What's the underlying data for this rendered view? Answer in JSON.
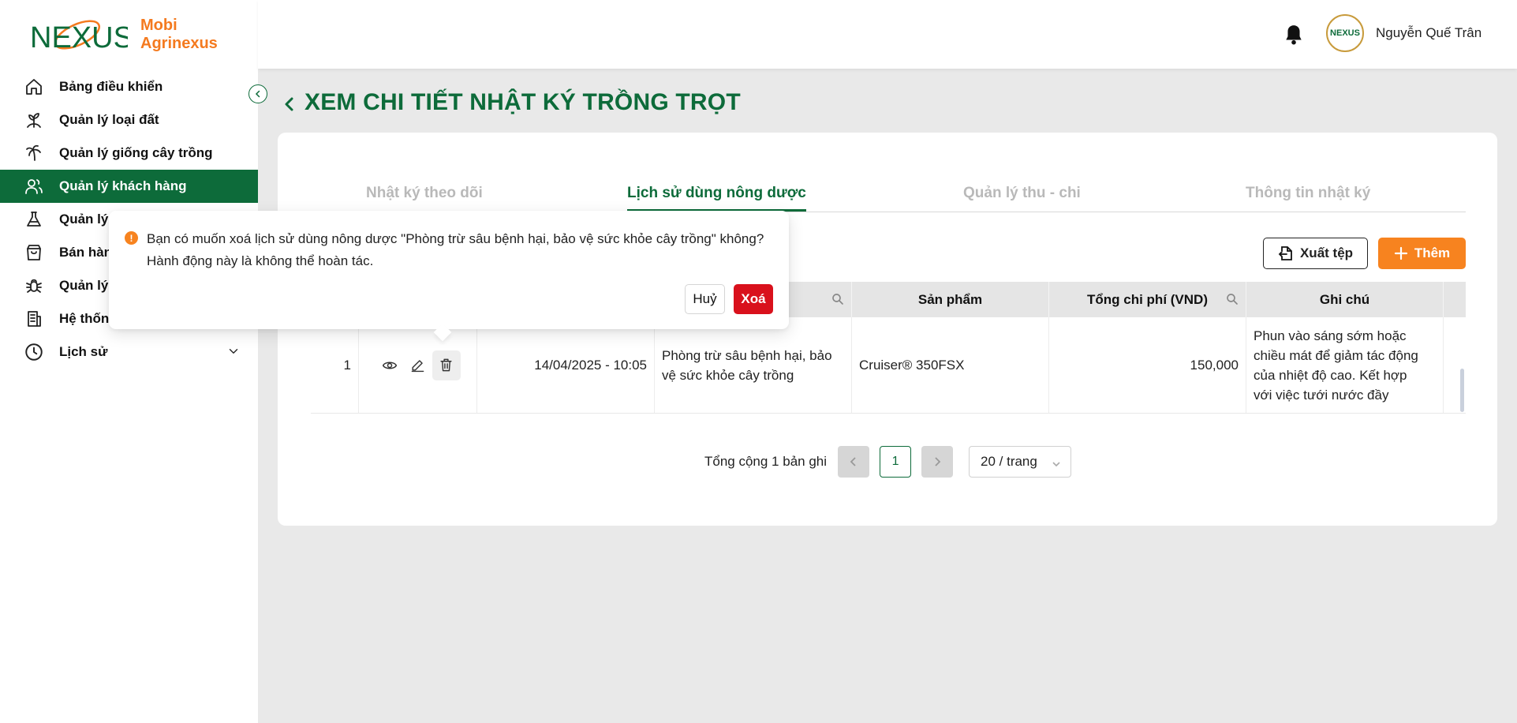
{
  "brand": {
    "logo_text": "NEXUS",
    "line1": "Mobi",
    "line2": "Agrinexus",
    "colors": {
      "primary_green": "#0d6b3a",
      "accent_orange": "#f7831f",
      "danger_red": "#d9111c"
    }
  },
  "sidebar": {
    "items": [
      {
        "label": "Bảng điều khiển",
        "icon": "home-icon"
      },
      {
        "label": "Quản lý loại đất",
        "icon": "soil-sprout-icon"
      },
      {
        "label": "Quản lý giống cây trồng",
        "icon": "palm-tree-icon"
      },
      {
        "label": "Quản lý khách hàng",
        "icon": "users-icon",
        "active": true
      },
      {
        "label": "Quản lý",
        "icon": "flask-icon"
      },
      {
        "label": "Bán hàn",
        "icon": "shopping-bag-icon"
      },
      {
        "label": "Quản lý",
        "icon": "bug-icon"
      },
      {
        "label": "Hệ thống",
        "icon": "building-icon"
      },
      {
        "label": "Lịch sử",
        "icon": "clock-history-icon",
        "has_submenu": true
      }
    ]
  },
  "header": {
    "username": "Nguyễn Quế Trân",
    "avatar_text": "NEXUS"
  },
  "page": {
    "title": "XEM CHI TIẾT NHẬT KÝ TRỒNG TRỌT"
  },
  "tabs": [
    {
      "label": "Nhật ký theo dõi",
      "active": false
    },
    {
      "label": "Lịch sử dùng nông dược",
      "active": true
    },
    {
      "label": "Quản lý thu - chi",
      "active": false
    },
    {
      "label": "Thông tin nhật ký",
      "active": false
    }
  ],
  "toolbar": {
    "export_label": "Xuất tệp",
    "add_label": "Thêm"
  },
  "table": {
    "columns": [
      "Sản phẩm",
      "Tổng chi phí (VND)",
      "Ghi chú"
    ],
    "rows": [
      {
        "index": "1",
        "datetime": "14/04/2025 - 10:05",
        "purpose": "Phòng trừ sâu bệnh hại, bảo vệ sức khỏe cây trồng",
        "product": "Cruiser® 350FSX",
        "cost": "150,000",
        "note": "Phun vào sáng sớm hoặc chiều mát để giảm tác động của nhiệt độ cao. Kết hợp với việc tưới nước đầy"
      }
    ]
  },
  "pagination": {
    "total_text": "Tổng cộng 1 bản ghi",
    "prev": "<",
    "current_page": "1",
    "next": ">",
    "page_size": "20 / trang"
  },
  "confirm": {
    "message_line1": "Bạn có muốn xoá lịch sử dùng nông dược \"Phòng trừ sâu bệnh hại, bảo vệ sức khỏe cây trồng\" không?",
    "message_line2": "Hành động này là không thể hoàn tác.",
    "icon_glyph": "!",
    "cancel_label": "Huỷ",
    "delete_label": "Xoá"
  }
}
